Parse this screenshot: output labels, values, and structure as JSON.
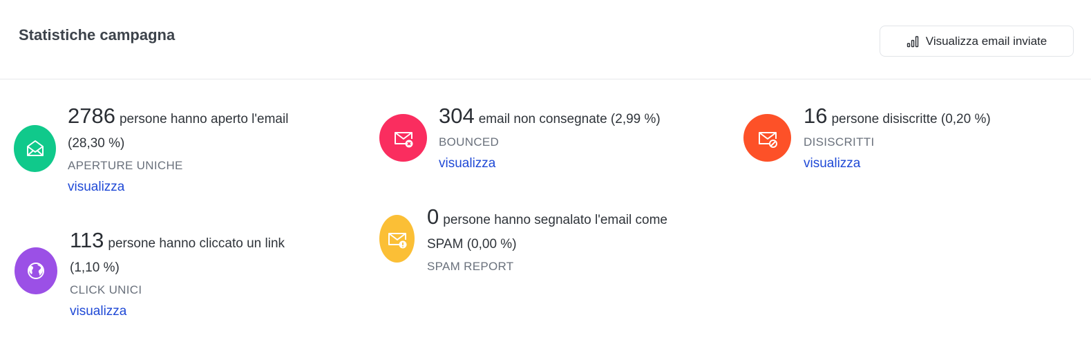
{
  "header": {
    "title": "Statistiche campagna",
    "view_button_label": "Visualizza email inviate"
  },
  "colors": {
    "opens": "#10c98b",
    "bounced": "#fa2d5f",
    "unsubscribed": "#fd5128",
    "clicks": "#9b50e6",
    "spam": "#fbbf36",
    "link": "#1f49d6"
  },
  "stats": {
    "opens": {
      "icon": "mail-open-icon",
      "count": "2786",
      "text": "persone hanno aperto l'email",
      "percent": "(28,30 %)",
      "caption": "APERTURE UNICHE",
      "link": "visualizza"
    },
    "bounced": {
      "icon": "mail-x-icon",
      "count": "304",
      "text": "email non consegnate (2,99 %)",
      "caption": "BOUNCED",
      "link": "visualizza"
    },
    "unsubscribed": {
      "icon": "mail-block-icon",
      "count": "16",
      "text": "persone disiscritte (0,20 %)",
      "caption": "DISISCRITTI",
      "link": "visualizza"
    },
    "clicks": {
      "icon": "globe-icon",
      "count": "113",
      "text": "persone hanno cliccato un link",
      "percent": "(1,10 %)",
      "caption": "CLICK UNICI",
      "link": "visualizza"
    },
    "spam": {
      "icon": "mail-alert-icon",
      "count": "0",
      "text": "persone hanno segnalato l'email come",
      "percent": "SPAM (0,00 %)",
      "caption": "SPAM REPORT"
    }
  }
}
